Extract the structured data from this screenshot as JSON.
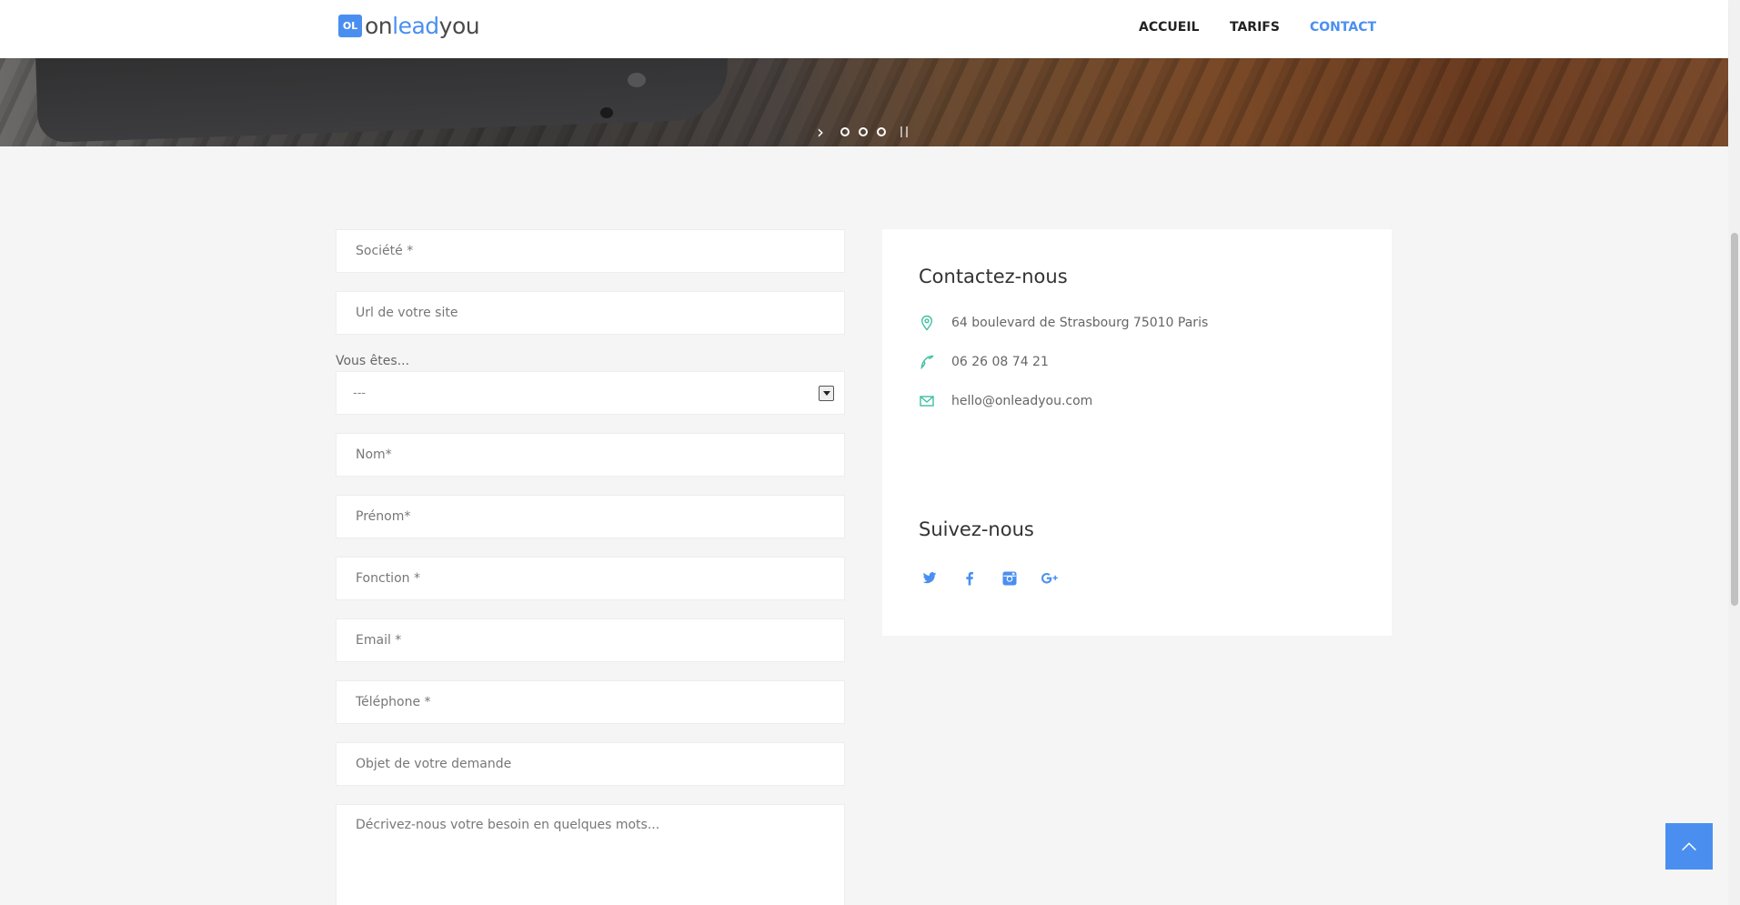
{
  "header": {
    "logo": {
      "mark": "OL",
      "text_part1": "on",
      "text_part2": "lead",
      "text_part3": "you"
    },
    "nav": [
      {
        "label": "ACCUEIL",
        "active": false
      },
      {
        "label": "TARIFS",
        "active": false
      },
      {
        "label": "CONTACT",
        "active": true
      }
    ]
  },
  "slider": {
    "dots": 3,
    "controls": {
      "next_icon": "chevron-right-icon",
      "pause_icon": "pause-icon"
    }
  },
  "form": {
    "societe": {
      "placeholder": "Société *"
    },
    "url": {
      "placeholder": "Url de votre site"
    },
    "vous_etes": {
      "label": "Vous êtes...",
      "selected": "---"
    },
    "nom": {
      "placeholder": "Nom*"
    },
    "prenom": {
      "placeholder": "Prénom*"
    },
    "fonction": {
      "placeholder": "Fonction *"
    },
    "email": {
      "placeholder": "Email *"
    },
    "telephone": {
      "placeholder": "Téléphone *"
    },
    "objet": {
      "placeholder": "Objet de votre demande"
    },
    "description": {
      "placeholder": "Décrivez-nous votre besoin en quelques mots..."
    }
  },
  "contact": {
    "title": "Contactez-nous",
    "address": "64 boulevard de Strasbourg 75010 Paris",
    "phone": "06 26 08 74 21",
    "email": "hello@onleadyou.com",
    "follow_title": "Suivez-nous",
    "socials": [
      "twitter-icon",
      "facebook-icon",
      "instagram-icon",
      "google-plus-icon"
    ]
  },
  "colors": {
    "accent": "#4a8ff0",
    "contact_icon": "#3fbf9f",
    "background": "#f5f5f5"
  },
  "back_to_top": {
    "icon": "chevron-up-icon"
  }
}
